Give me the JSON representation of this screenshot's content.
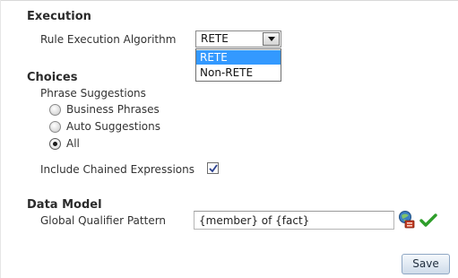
{
  "execution": {
    "heading": "Execution",
    "algorithm_label": "Rule Execution Algorithm",
    "selected_value": "RETE",
    "options": [
      "RETE",
      "Non-RETE"
    ]
  },
  "choices": {
    "heading": "Choices",
    "phrase_label": "Phrase Suggestions",
    "radios": [
      {
        "label": "Business Phrases",
        "checked": false
      },
      {
        "label": "Auto Suggestions",
        "checked": false
      },
      {
        "label": "All",
        "checked": true
      }
    ],
    "chained_label": "Include Chained Expressions",
    "chained_checked": true
  },
  "data_model": {
    "heading": "Data Model",
    "pattern_label": "Global Qualifier Pattern",
    "pattern_value": "{member} of {fact}",
    "icons": [
      "expression-builder-icon",
      "validate-check-icon"
    ]
  },
  "actions": {
    "save_label": "Save"
  },
  "colors": {
    "selection": "#3399ff",
    "check_green": "#2e9e2a"
  }
}
